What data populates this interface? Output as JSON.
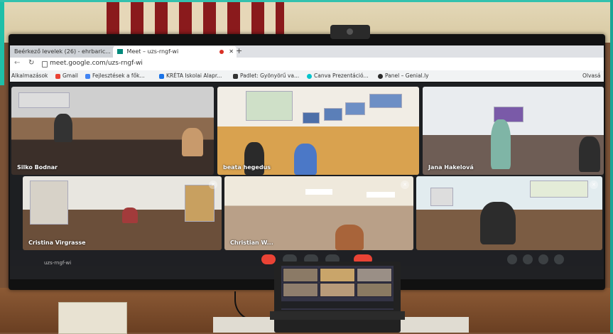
{
  "browser": {
    "tabs": [
      {
        "label": "Beérkező levelek (26) - ehrbaric..."
      },
      {
        "label": "Meet – uzs-rngf-wi"
      }
    ],
    "new_tab": "+",
    "close": "✕",
    "url": "meet.google.com/uzs-rngf-wi",
    "bookmarks": [
      {
        "label": "Alkalmazások",
        "color": "#5f6368"
      },
      {
        "label": "Gmail",
        "color": "#ea4335"
      },
      {
        "label": "Fejlesztések a fők...",
        "color": "#4285f4"
      },
      {
        "label": "KRÉTA Iskolai Alapr...",
        "color": "#1a73e8"
      },
      {
        "label": "Padlet: Gyönyörű va...",
        "color": "#333333"
      },
      {
        "label": "Canva Prezentáció...",
        "color": "#00c4cc"
      },
      {
        "label": "Panel – Genial.ly",
        "color": "#2b2b2b"
      },
      {
        "label": "Olvasá",
        "color": "#5f6368"
      }
    ]
  },
  "meet": {
    "participants": [
      {
        "name": "Silko Bodnar"
      },
      {
        "name": "beata hegedus"
      },
      {
        "name": "Jana Hakelová"
      },
      {
        "name": "Cristina Virgrasse"
      },
      {
        "name": "Christian W..."
      },
      {
        "name": ""
      }
    ],
    "meeting_code": "uzs-rngf-wi"
  }
}
